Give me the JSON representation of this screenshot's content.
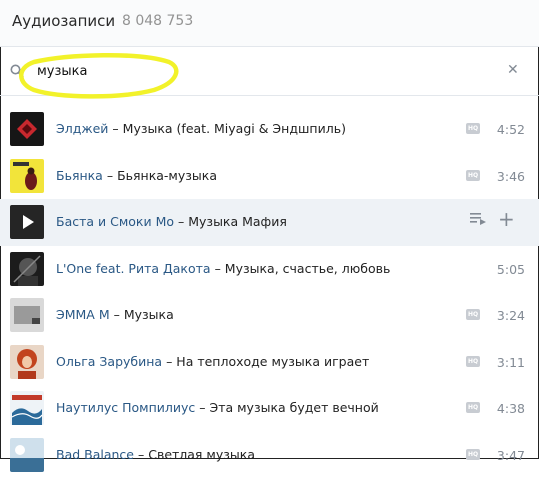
{
  "header": {
    "title": "Аудиозаписи",
    "count": "8 048 753"
  },
  "search": {
    "query": "музыка"
  },
  "tracks": [
    {
      "artist": "Элджей",
      "title": "Музыка (feat. Miyagi & Эндшпиль)",
      "hq": true,
      "duration": "4:52"
    },
    {
      "artist": "Бьянка",
      "title": "Бьянка-музыка",
      "hq": true,
      "duration": "3:46"
    },
    {
      "artist": "Баста и Смоки Мо",
      "title": "Музыка Мафия",
      "hq": false,
      "duration": ""
    },
    {
      "artist": "L'One feat. Рита Дакота",
      "title": "Музыка, счастье, любовь",
      "hq": false,
      "duration": "5:05"
    },
    {
      "artist": "ЭММА М",
      "title": "Музыка",
      "hq": true,
      "duration": "3:24"
    },
    {
      "artist": "Ольга Зарубина",
      "title": "На теплоходе музыка играет",
      "hq": true,
      "duration": "3:11"
    },
    {
      "artist": "Наутилус Помпилиус",
      "title": "Эта музыка будет вечной",
      "hq": true,
      "duration": "4:38"
    },
    {
      "artist": "Bad Balance",
      "title": "Светлая музыка",
      "hq": true,
      "duration": "3:47"
    }
  ],
  "dash": "–",
  "hq_label": "HQ",
  "colors": {
    "accent": "#2a5885",
    "highlight": "#f2f22a",
    "muted": "#828a94"
  },
  "icons": {
    "search": "search-icon",
    "clear": "close-icon",
    "play": "play-icon",
    "add_to_playlist": "playlist-add-icon",
    "add": "plus-icon"
  }
}
